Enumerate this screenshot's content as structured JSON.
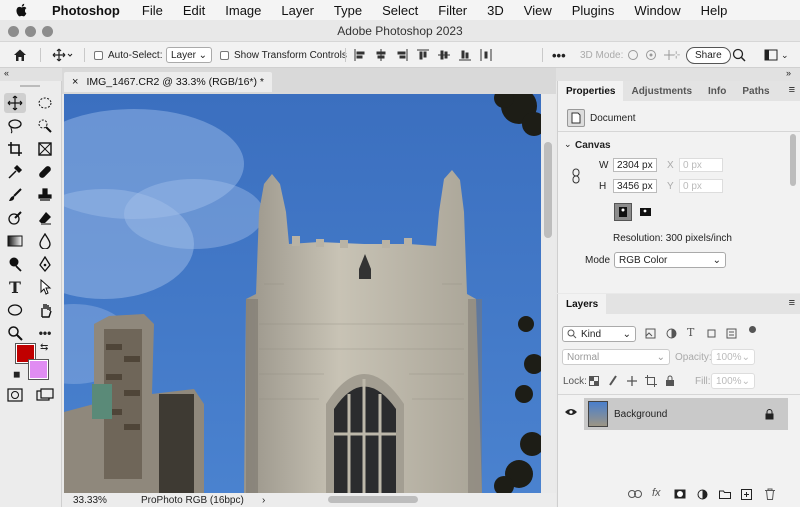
{
  "menubar": {
    "app": "Photoshop",
    "items": [
      "File",
      "Edit",
      "Image",
      "Layer",
      "Type",
      "Select",
      "Filter",
      "3D",
      "View",
      "Plugins",
      "Window",
      "Help"
    ]
  },
  "window": {
    "title": "Adobe Photoshop 2023"
  },
  "options": {
    "auto_select_label": "Auto-Select:",
    "auto_select_target": "Layer",
    "transform_controls_label": "Show Transform Controls",
    "mode_3d_label": "3D Mode:",
    "share_label": "Share"
  },
  "document": {
    "tab_title": "IMG_1467.CR2 @ 33.3% (RGB/16*) *",
    "zoom": "33.33%",
    "profile": "ProPhoto RGB (16bpc)"
  },
  "colors": {
    "foreground": "#c00000",
    "background": "#e08cf2"
  },
  "properties": {
    "tabs": [
      "Properties",
      "Adjustments",
      "Info",
      "Paths"
    ],
    "active_tab": "Properties",
    "section_label": "Document",
    "canvas_label": "Canvas",
    "w_label": "W",
    "w_value": "2304 px",
    "h_label": "H",
    "h_value": "3456 px",
    "x_label": "X",
    "x_placeholder": "0 px",
    "y_label": "Y",
    "y_placeholder": "0 px",
    "resolution": "Resolution: 300 pixels/inch",
    "mode_label": "Mode",
    "mode_value": "RGB Color"
  },
  "layers": {
    "tab": "Layers",
    "filter_kind": "Kind",
    "blend_mode": "Normal",
    "opacity_label": "Opacity:",
    "opacity_value": "100%",
    "lock_label": "Lock:",
    "fill_label": "Fill:",
    "fill_value": "100%",
    "items": [
      {
        "name": "Background",
        "visible": true,
        "locked": true
      }
    ]
  }
}
